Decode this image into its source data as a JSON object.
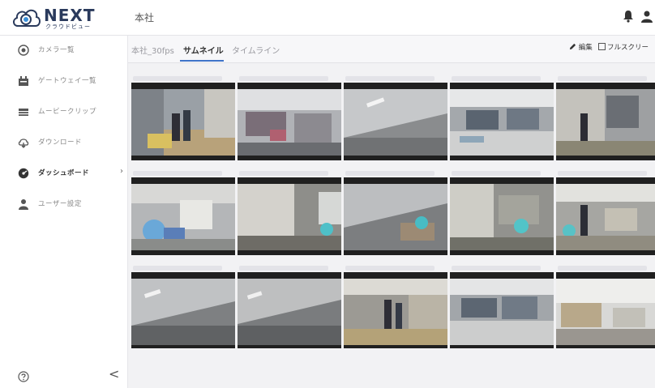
{
  "header": {
    "brand": "NEXT",
    "brand_sub": "クラウドビュー",
    "page_title": "本社"
  },
  "sidebar": {
    "items": [
      {
        "label": "カメラ一覧",
        "icon": "camera-icon"
      },
      {
        "label": "ゲートウェイ一覧",
        "icon": "gateway-icon"
      },
      {
        "label": "ムービークリップ",
        "icon": "movie-icon"
      },
      {
        "label": "ダウンロード",
        "icon": "download-icon"
      },
      {
        "label": "ダッシュボード",
        "icon": "dashboard-icon",
        "active": true
      },
      {
        "label": "ユーザー設定",
        "icon": "user-icon"
      }
    ],
    "collapse_label": "<"
  },
  "tabs": [
    {
      "label": "本社_30fps"
    },
    {
      "label": "サムネイル",
      "active": true
    },
    {
      "label": "タイムライン"
    }
  ],
  "toolbar": {
    "edit_label": "編集",
    "fullscreen_label": "フルスクリー"
  },
  "colors": {
    "accent": "#3f74c9",
    "brand": "#2a3a5c"
  }
}
